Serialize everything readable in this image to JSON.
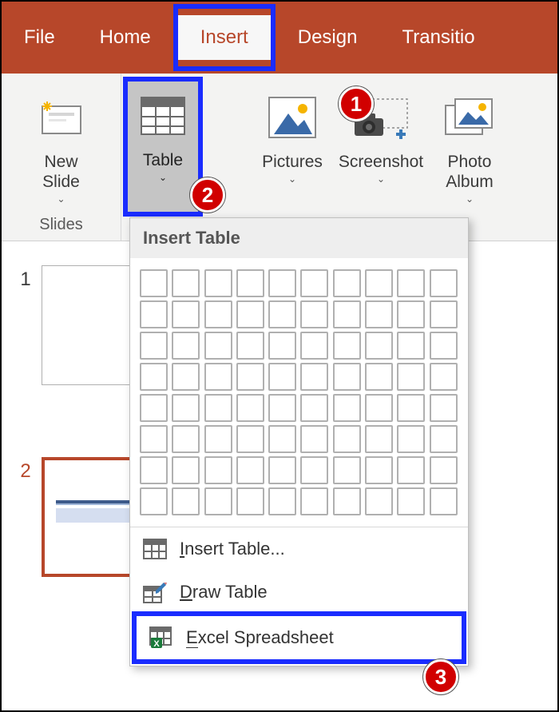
{
  "tabs": {
    "file": "File",
    "home": "Home",
    "insert": "Insert",
    "design": "Design",
    "transitions": "Transitio"
  },
  "ribbon": {
    "new_slide": {
      "label": "New\nSlide"
    },
    "table": {
      "label": "Table"
    },
    "pictures": {
      "label": "Pictures"
    },
    "screenshot": {
      "label": "Screenshot"
    },
    "photo_album": {
      "label": "Photo\nAlbum"
    },
    "group_slides": "Slides"
  },
  "slides": {
    "items": [
      {
        "num": "1"
      },
      {
        "num": "2"
      }
    ]
  },
  "dropdown": {
    "header": "Insert Table",
    "grid": {
      "rows": 8,
      "cols": 10
    },
    "insert_table": "Insert Table...",
    "draw_table": "Draw Table",
    "excel_spreadsheet": "Excel Spreadsheet"
  },
  "callouts": {
    "one": "1",
    "two": "2",
    "three": "3"
  },
  "colors": {
    "brand": "#b7472a",
    "highlight": "#1a2cff",
    "badge": "#d10000"
  }
}
